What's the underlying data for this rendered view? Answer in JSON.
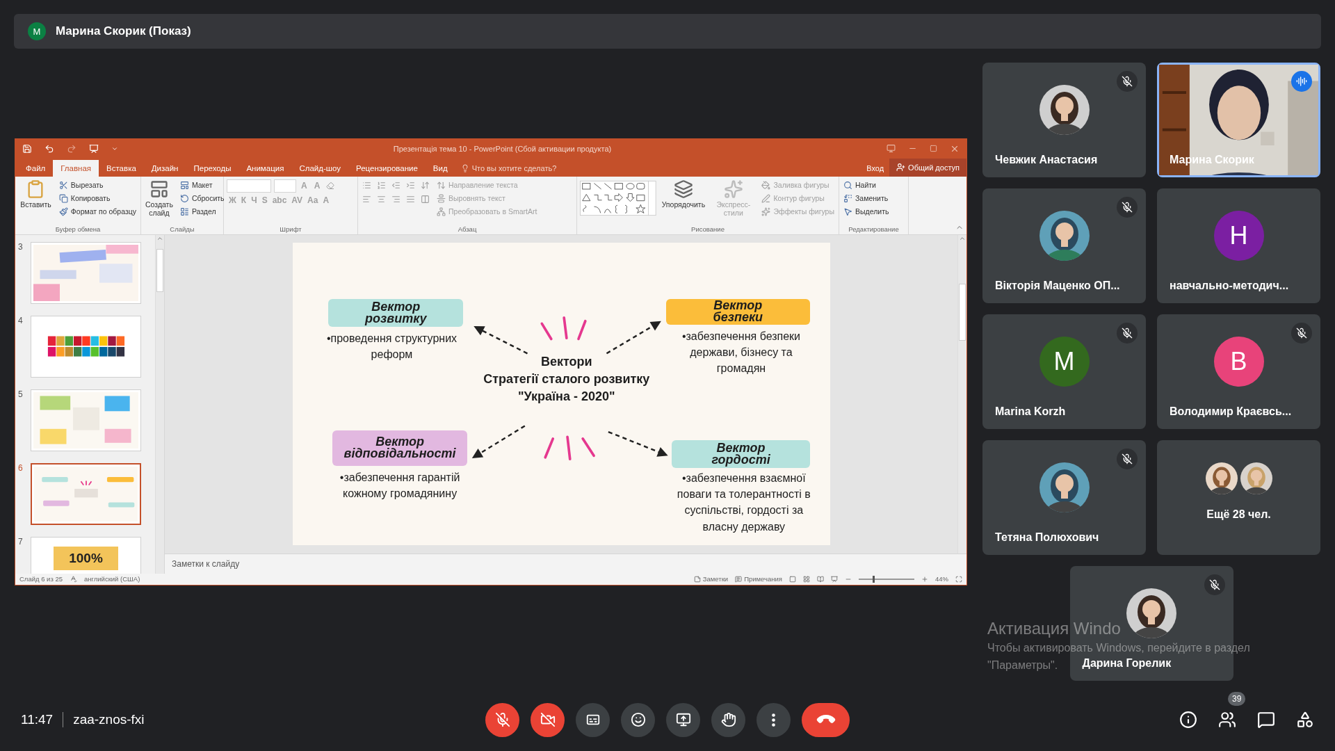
{
  "meet": {
    "presenter": {
      "initial": "M",
      "label": "Марина Скорик (Показ)"
    },
    "time": "11:47",
    "meeting_code": "zaa-znos-fxi",
    "mic_on": false,
    "camera_on": false,
    "people_count": "39"
  },
  "ppt": {
    "title": "Презентація тема 10 - PowerPoint (Сбой активации продукта)",
    "tabs": [
      {
        "label": "Файл",
        "selected": false
      },
      {
        "label": "Главная",
        "selected": true
      },
      {
        "label": "Вставка",
        "selected": false
      },
      {
        "label": "Дизайн",
        "selected": false
      },
      {
        "label": "Переходы",
        "selected": false
      },
      {
        "label": "Анимация",
        "selected": false
      },
      {
        "label": "Слайд-шоу",
        "selected": false
      },
      {
        "label": "Рецензирование",
        "selected": false
      },
      {
        "label": "Вид",
        "selected": false
      }
    ],
    "tell_me": "Что вы хотите сделать?",
    "sign_in": "Вход",
    "share": "Общий доступ",
    "ribbon": [
      {
        "kind": "clipboard",
        "label": "Буфер обмена",
        "big": [
          {
            "label": "Вставить",
            "disabled": false
          }
        ],
        "items": [
          {
            "label": "Вырезать",
            "disabled": false
          },
          {
            "label": "Копировать",
            "disabled": false
          },
          {
            "label": "Формат по образцу",
            "disabled": false
          }
        ]
      },
      {
        "kind": "slides",
        "label": "Слайды",
        "big": [
          {
            "label": "Создать слайд",
            "disabled": false
          }
        ],
        "items": [
          {
            "label": "Макет",
            "disabled": false
          },
          {
            "label": "Сбросить",
            "disabled": false
          },
          {
            "label": "Раздел",
            "disabled": false
          }
        ]
      },
      {
        "kind": "font",
        "label": "Шрифт",
        "items": [
          {
            "label": "A",
            "disabled": true
          },
          {
            "label": "A",
            "disabled": true
          },
          {
            "label": "Ж",
            "disabled": true
          },
          {
            "label": "К",
            "disabled": true
          },
          {
            "label": "Ч",
            "disabled": true
          },
          {
            "label": "S",
            "disabled": true
          },
          {
            "label": "abc",
            "disabled": true
          },
          {
            "label": "AV",
            "disabled": true
          },
          {
            "label": "Aa",
            "disabled": true
          },
          {
            "label": "A",
            "disabled": true
          }
        ]
      },
      {
        "kind": "paragraph",
        "label": "Абзац",
        "items": [
          {
            "label": "Направление текста",
            "disabled": true
          },
          {
            "label": "Выровнять текст",
            "disabled": true
          },
          {
            "label": "Преобразовать в SmartArt",
            "disabled": true
          }
        ]
      },
      {
        "kind": "drawing",
        "label": "Рисование",
        "big": [
          {
            "label": "Упорядочить",
            "disabled": false
          },
          {
            "label": "Экспресс-стили",
            "disabled": true
          }
        ],
        "items": [
          {
            "label": "Заливка фигуры",
            "disabled": true
          },
          {
            "label": "Контур фигуры",
            "disabled": true
          },
          {
            "label": "Эффекты фигуры",
            "disabled": true
          }
        ]
      },
      {
        "kind": "editing",
        "label": "Редактирование",
        "items": [
          {
            "label": "Найти",
            "disabled": false
          },
          {
            "label": "Заменить",
            "disabled": false
          },
          {
            "label": "Выделить",
            "disabled": false
          }
        ]
      }
    ],
    "thumbnails": [
      {
        "number": "3",
        "selected": false,
        "kind": "picture"
      },
      {
        "number": "4",
        "selected": false,
        "kind": "picture"
      },
      {
        "number": "5",
        "selected": false,
        "kind": "picture"
      },
      {
        "number": "6",
        "selected": true,
        "kind": "picture"
      },
      {
        "number": "7",
        "selected": false,
        "kind": "text",
        "text": "100%"
      }
    ],
    "slide": {
      "title": [
        "Вектори",
        "Стратегії сталого розвитку",
        "\"Україна - 2020\""
      ],
      "vectors": [
        {
          "label": "Вектор розвитку",
          "text": "•проведення структурних реформ",
          "color": "#b5e2dd"
        },
        {
          "label": "Вектор безпеки",
          "text": "•забезпечення безпеки держави, бізнесу та громадян",
          "color": "#fbbd3a"
        },
        {
          "label": "Вектор відповідальності",
          "text": "•забезпечення гарантій кожному громадянину",
          "color": "#e2b8e0"
        },
        {
          "label": "Вектор гордості",
          "text": "•забезпечення взаємної поваги та толерантності в суспільстві, гордості за власну державу",
          "color": "#b5e2dd"
        }
      ]
    },
    "notes_placeholder": "Заметки к слайду",
    "status": {
      "slide": "Слайд 6 из 25",
      "language": "английский (США)",
      "notes": "Заметки",
      "comments": "Примечания",
      "zoom": "44%",
      "zoom_slider": {
        "level": 0.25
      }
    }
  },
  "participants": [
    {
      "name": "Чевжик Анастасия",
      "muted": true,
      "speaking": false
    },
    {
      "name": "Марина Скорик",
      "kind": "video",
      "muted": false,
      "speaking": true
    },
    {
      "name": "Вікторія Маценко ОП...",
      "muted": true,
      "speaking": false
    },
    {
      "name": "навчально-методич...",
      "kind": "initial",
      "initial": "Н",
      "color": "#7b1fa2",
      "muted": false,
      "speaking": false
    },
    {
      "name": "Marina Korzh",
      "kind": "initial",
      "initial": "M",
      "color": "#33691e",
      "muted": true,
      "speaking": false
    },
    {
      "name": "Володимир Краєвсь...",
      "kind": "initial",
      "initial": "В",
      "color": "#e8437a",
      "muted": true,
      "speaking": false
    },
    {
      "name": "Тетяна Полюхович",
      "muted": true,
      "speaking": false
    },
    {
      "name": "Ещё 28 чел.",
      "kind": "others",
      "muted": false,
      "speaking": false
    },
    {
      "name": "Дарина Горелик",
      "muted": true,
      "speaking": false
    }
  ],
  "watermark": {
    "title": "Активация Windo",
    "text": [
      "Чтобы активировать Windows, перейдите в раздел",
      "\"Параметры\"."
    ]
  }
}
